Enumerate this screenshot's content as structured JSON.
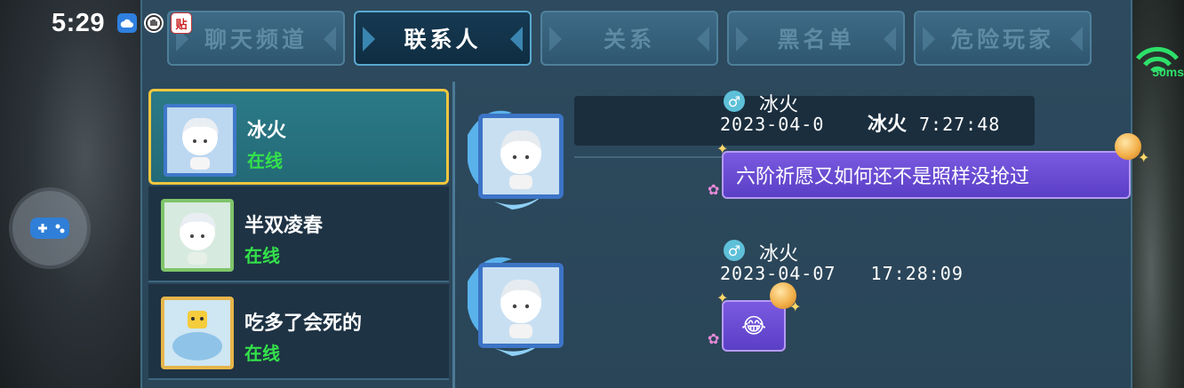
{
  "status_bar": {
    "time": "5:29",
    "icons": [
      "cloud-icon",
      "hand-icon",
      "tieba-icon"
    ],
    "tieba_label": "贴"
  },
  "network": {
    "label": "50ms",
    "color": "#2ee06a"
  },
  "tabs": [
    {
      "label": "聊天频道",
      "active": false
    },
    {
      "label": "联系人",
      "active": true
    },
    {
      "label": "关系",
      "active": false
    },
    {
      "label": "黑名单",
      "active": false
    },
    {
      "label": "危险玩家",
      "active": false
    }
  ],
  "contacts": [
    {
      "name": "冰火",
      "status": "在线",
      "selected": true
    },
    {
      "name": "半双凌春",
      "status": "在线",
      "selected": false
    },
    {
      "name": "吃多了会死的",
      "status": "在线",
      "selected": false
    }
  ],
  "chat": {
    "overlay_name": "冰火",
    "messages": [
      {
        "gender": "♂",
        "sender": "冰火",
        "time": "2023-04-0",
        "time_tail": "7:27:48",
        "text": "六阶祈愿又如何还不是照样没抢过"
      },
      {
        "gender": "♂",
        "sender": "冰火",
        "time": "2023-04-07   17:28:09",
        "emoji": "😂"
      }
    ]
  },
  "colors": {
    "accent": "#f0c640",
    "online": "#34e24a",
    "bubble": "#6a4ed6",
    "panel": "#2d4a5e"
  }
}
